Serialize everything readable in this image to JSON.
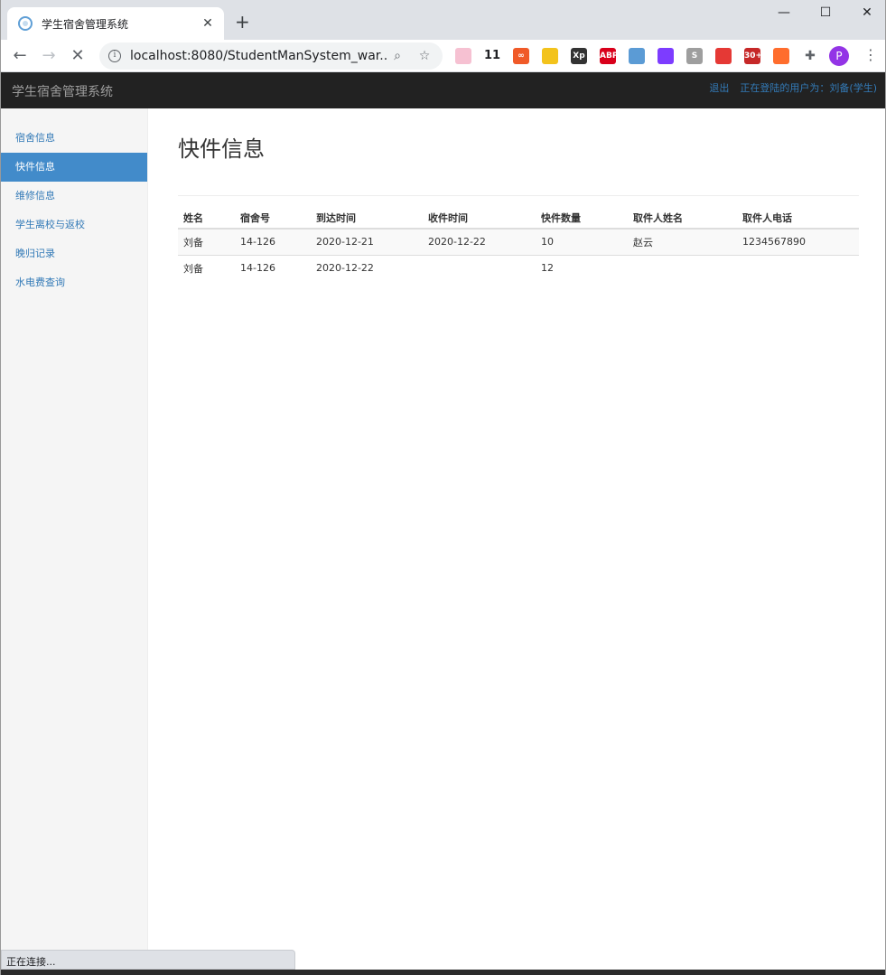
{
  "browser": {
    "tab_title": "学生宿舍管理系统",
    "tab_close": "✕",
    "new_tab": "+",
    "url": "localhost:8080/StudentManSystem_war...",
    "controls": {
      "minimize": "—",
      "maximize": "☐",
      "close": "✕"
    },
    "extensions": [
      {
        "name": "extension-1-icon",
        "label": "",
        "color": "#f6c1d2"
      },
      {
        "name": "extension-2-icon",
        "label": "11",
        "color": "#ffffff"
      },
      {
        "name": "extension-3-icon",
        "label": "∞",
        "color": "#f05a28"
      },
      {
        "name": "extension-4-icon",
        "label": "",
        "color": "#f3c31c"
      },
      {
        "name": "extension-5-icon",
        "label": "Xp",
        "color": "#333333"
      },
      {
        "name": "adblock-icon",
        "label": "ABP",
        "color": "#d9001b"
      },
      {
        "name": "extension-7-icon",
        "label": "",
        "color": "#5b9bd5"
      },
      {
        "name": "extension-8-icon",
        "label": "",
        "color": "#7d3cff"
      },
      {
        "name": "extension-9-icon",
        "label": "S",
        "color": "#9e9e9e"
      },
      {
        "name": "extension-10-icon",
        "label": "",
        "color": "#e53935"
      },
      {
        "name": "extension-11-icon",
        "label": "30+",
        "color": "#c62828"
      },
      {
        "name": "extension-12-icon",
        "label": "",
        "color": "#ff6d2d"
      },
      {
        "name": "puzzle-icon",
        "label": "✚",
        "color": "#5f6368"
      }
    ],
    "avatar_letter": "P",
    "status_text": "正在连接..."
  },
  "app": {
    "brand": "学生宿舍管理系统",
    "logout": "退出",
    "logged_in_user": "正在登陆的用户为：刘备(学生)"
  },
  "sidebar": {
    "items": [
      {
        "label": "宿舍信息",
        "active": false
      },
      {
        "label": "快件信息",
        "active": true
      },
      {
        "label": "维修信息",
        "active": false
      },
      {
        "label": "学生离校与返校",
        "active": false
      },
      {
        "label": "晚归记录",
        "active": false
      },
      {
        "label": "水电费查询",
        "active": false
      }
    ]
  },
  "main": {
    "title": "快件信息",
    "columns": [
      "姓名",
      "宿舍号",
      "到达时间",
      "收件时间",
      "快件数量",
      "取件人姓名",
      "取件人电话"
    ],
    "rows": [
      [
        "刘备",
        "14-126",
        "2020-12-21",
        "2020-12-22",
        "10",
        "赵云",
        "1234567890"
      ],
      [
        "刘备",
        "14-126",
        "2020-12-22",
        "",
        "12",
        "",
        ""
      ]
    ]
  }
}
